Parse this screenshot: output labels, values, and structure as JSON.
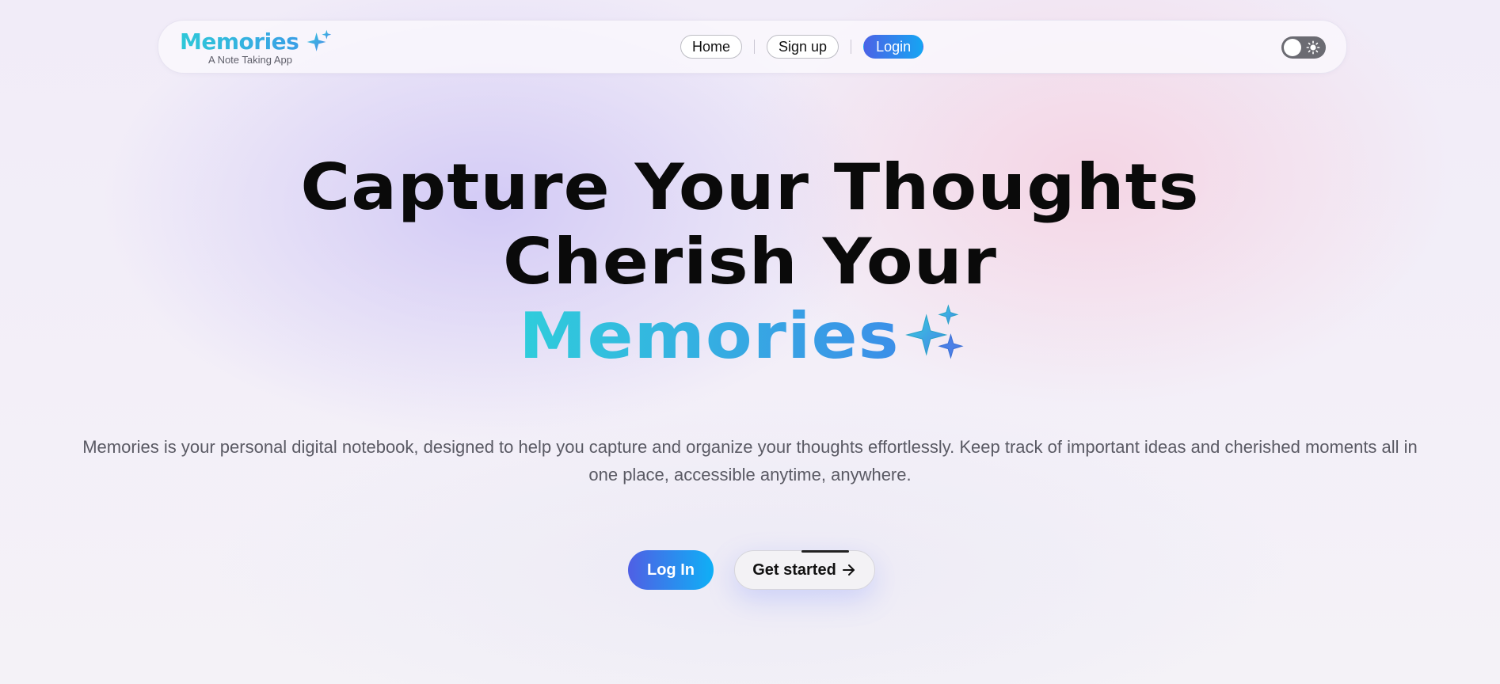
{
  "brand": {
    "name": "Memories",
    "tagline": "A Note Taking App",
    "icon": "sparkles-icon"
  },
  "nav": {
    "home_label": "Home",
    "signup_label": "Sign up",
    "login_label": "Login"
  },
  "theme_toggle": {
    "icon": "sun-icon",
    "state": "light"
  },
  "hero": {
    "line1": "Capture Your Thoughts",
    "line2": "Cherish Your",
    "line3": "Memories",
    "icon": "sparkles-icon",
    "description": "Memories is your personal digital notebook, designed to help you capture and organize your thoughts effortlessly. Keep track of important ideas and cherished moments all in one place, accessible anytime, anywhere."
  },
  "cta": {
    "login_label": "Log In",
    "get_started_label": "Get started",
    "get_started_icon": "arrow-right-icon"
  },
  "colors": {
    "accent_gradient_start": "#4f5fe4",
    "accent_gradient_end": "#0fb0f6",
    "brand_gradient_start": "#2ec8d8",
    "brand_gradient_end": "#3a9fe6"
  }
}
